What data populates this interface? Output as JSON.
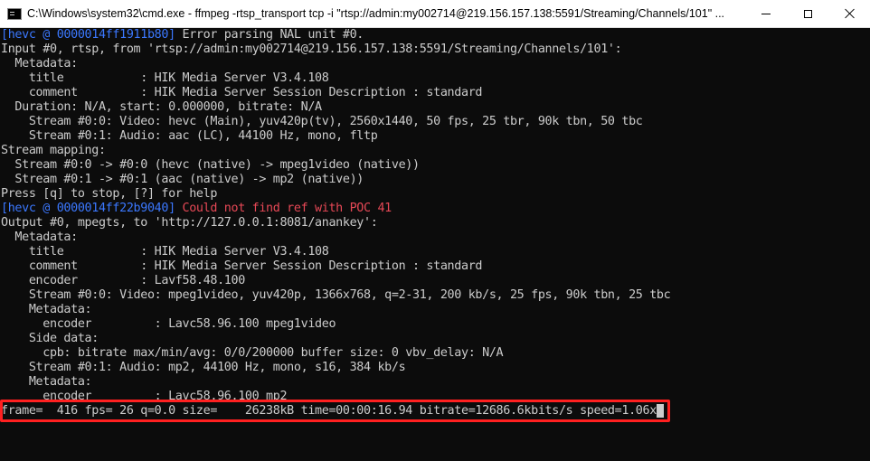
{
  "window": {
    "title": "C:\\Windows\\system32\\cmd.exe - ffmpeg  -rtsp_transport tcp -i \"rtsp://admin:my002714@219.156.157.138:5591/Streaming/Channels/101\" ...",
    "icon": "cmd-icon"
  },
  "colors": {
    "background": "#0c0c0c",
    "text": "#cccccc",
    "log_prefix": "#3b78ff",
    "error": "#e74856",
    "highlight_box": "#ff2020"
  },
  "console": {
    "lines": [
      {
        "prefix": "[hevc @ 0000014ff1911b80]",
        "text": " Error parsing NAL unit #0.",
        "style": "normal"
      },
      {
        "text": "Input #0, rtsp, from 'rtsp://admin:my002714@219.156.157.138:5591/Streaming/Channels/101':"
      },
      {
        "text": "  Metadata:"
      },
      {
        "text": "    title           : HIK Media Server V3.4.108"
      },
      {
        "text": "    comment         : HIK Media Server Session Description : standard"
      },
      {
        "text": "  Duration: N/A, start: 0.000000, bitrate: N/A"
      },
      {
        "text": "    Stream #0:0: Video: hevc (Main), yuv420p(tv), 2560x1440, 50 fps, 25 tbr, 90k tbn, 50 tbc"
      },
      {
        "text": "    Stream #0:1: Audio: aac (LC), 44100 Hz, mono, fltp"
      },
      {
        "text": "Stream mapping:"
      },
      {
        "text": "  Stream #0:0 -> #0:0 (hevc (native) -> mpeg1video (native))"
      },
      {
        "text": "  Stream #0:1 -> #0:1 (aac (native) -> mp2 (native))"
      },
      {
        "text": "Press [q] to stop, [?] for help"
      },
      {
        "prefix": "[hevc @ 0000014ff22b9040]",
        "text": " Could not find ref with POC 41",
        "style": "error"
      },
      {
        "text": "Output #0, mpegts, to 'http://127.0.0.1:8081/anankey':"
      },
      {
        "text": "  Metadata:"
      },
      {
        "text": "    title           : HIK Media Server V3.4.108"
      },
      {
        "text": "    comment         : HIK Media Server Session Description : standard"
      },
      {
        "text": "    encoder         : Lavf58.48.100"
      },
      {
        "text": "    Stream #0:0: Video: mpeg1video, yuv420p, 1366x768, q=2-31, 200 kb/s, 25 fps, 90k tbn, 25 tbc"
      },
      {
        "text": "    Metadata:"
      },
      {
        "text": "      encoder         : Lavc58.96.100 mpeg1video"
      },
      {
        "text": "    Side data:"
      },
      {
        "text": "      cpb: bitrate max/min/avg: 0/0/200000 buffer size: 0 vbv_delay: N/A"
      },
      {
        "text": "    Stream #0:1: Audio: mp2, 44100 Hz, mono, s16, 384 kb/s"
      },
      {
        "text": "    Metadata:"
      },
      {
        "text": "      encoder         : Lavc58.96.100 mp2"
      },
      {
        "text": "frame=  416 fps= 26 q=0.0 size=    26238kB time=00:00:16.94 bitrate=12686.6kbits/s speed=1.06x",
        "highlighted": true
      }
    ]
  }
}
